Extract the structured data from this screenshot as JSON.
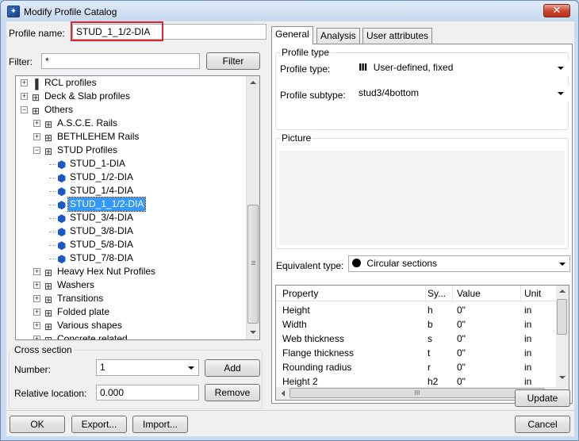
{
  "window": {
    "title": "Modify Profile Catalog",
    "close_glyph": "✕"
  },
  "profile_name": {
    "label": "Profile name:",
    "value": "STUD_1_1/2-DIA"
  },
  "filter": {
    "label": "Filter:",
    "value": "*",
    "button": "Filter"
  },
  "tree": {
    "items": [
      {
        "label": "RCL profiles",
        "level": 0,
        "expander": "+",
        "icon": "rcl-icon"
      },
      {
        "label": "Deck & Slab profiles",
        "level": 0,
        "expander": "+",
        "icon": "folder-icon"
      },
      {
        "label": "Others",
        "level": 0,
        "expander": "−",
        "icon": "folder-icon"
      },
      {
        "label": "A.S.C.E. Rails",
        "level": 1,
        "expander": "+",
        "icon": "folder-icon"
      },
      {
        "label": "BETHLEHEM Rails",
        "level": 1,
        "expander": "+",
        "icon": "folder-icon"
      },
      {
        "label": "STUD Profiles",
        "level": 1,
        "expander": "−",
        "icon": "folder-icon"
      },
      {
        "label": "STUD_1-DIA",
        "level": 2,
        "icon": "stud-icon"
      },
      {
        "label": "STUD_1/2-DIA",
        "level": 2,
        "icon": "stud-icon"
      },
      {
        "label": "STUD_1/4-DIA",
        "level": 2,
        "icon": "stud-icon"
      },
      {
        "label": "STUD_1_1/2-DIA",
        "level": 2,
        "icon": "stud-icon",
        "selected": true
      },
      {
        "label": "STUD_3/4-DIA",
        "level": 2,
        "icon": "stud-icon"
      },
      {
        "label": "STUD_3/8-DIA",
        "level": 2,
        "icon": "stud-icon"
      },
      {
        "label": "STUD_5/8-DIA",
        "level": 2,
        "icon": "stud-icon"
      },
      {
        "label": "STUD_7/8-DIA",
        "level": 2,
        "icon": "stud-icon"
      },
      {
        "label": "Heavy Hex Nut Profiles",
        "level": 1,
        "expander": "+",
        "icon": "folder-icon"
      },
      {
        "label": "Washers",
        "level": 1,
        "expander": "+",
        "icon": "folder-icon"
      },
      {
        "label": "Transitions",
        "level": 1,
        "expander": "+",
        "icon": "folder-icon"
      },
      {
        "label": "Folded plate",
        "level": 1,
        "expander": "+",
        "icon": "folder-icon"
      },
      {
        "label": "Various shapes",
        "level": 1,
        "expander": "+",
        "icon": "folder-icon"
      },
      {
        "label": "Concrete related",
        "level": 1,
        "expander": "+",
        "icon": "folder-icon"
      }
    ]
  },
  "cross_section": {
    "title": "Cross section",
    "number_label": "Number:",
    "number_value": "1",
    "add_button": "Add",
    "location_label": "Relative location:",
    "location_value": "0.000",
    "remove_button": "Remove"
  },
  "tabs": [
    "General",
    "Analysis",
    "User attributes"
  ],
  "general": {
    "profile_type_group": "Profile type",
    "profile_type_label": "Profile type:",
    "profile_type_value": "User-defined, fixed",
    "profile_subtype_label": "Profile subtype:",
    "profile_subtype_value": "stud3/4bottom",
    "picture_group": "Picture",
    "equivalent_type_label": "Equivalent type:",
    "equivalent_type_value": "Circular sections"
  },
  "properties": {
    "headers": [
      "Property",
      "Sy...",
      "Value",
      "Unit"
    ],
    "rows": [
      [
        "Height",
        "h",
        "0\"",
        "in"
      ],
      [
        "Width",
        "b",
        "0\"",
        "in"
      ],
      [
        "Web thickness",
        "s",
        "0\"",
        "in"
      ],
      [
        "Flange thickness",
        "t",
        "0\"",
        "in"
      ],
      [
        "Rounding radius",
        "r",
        "0\"",
        "in"
      ],
      [
        "Height 2",
        "h2",
        "0\"",
        "in"
      ]
    ],
    "hscroll_grip": "III"
  },
  "buttons": {
    "update": "Update",
    "ok": "OK",
    "export": "Export...",
    "import": "Import...",
    "cancel": "Cancel"
  },
  "colors": {
    "selection": "#3399ff",
    "highlight_border": "#e0262a",
    "stud_icon": "#1c57c7"
  }
}
